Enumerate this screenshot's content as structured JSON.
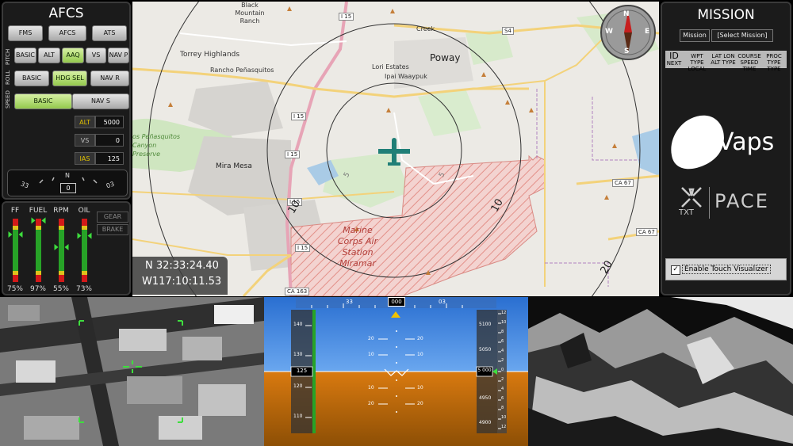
{
  "afcs": {
    "title": "AFCS",
    "top_buttons": [
      "FMS",
      "AFCS",
      "ATS"
    ],
    "pitch_label": "PITCH",
    "pitch_buttons": [
      "BASIC",
      "ALT",
      "AAQ",
      "VS",
      "NAV P"
    ],
    "roll_label": "ROLL",
    "roll_buttons": [
      "BASIC",
      "HDG SEL",
      "NAV R"
    ],
    "speed_label": "SPEED",
    "speed_buttons": [
      "BASIC",
      "NAV S"
    ],
    "readouts": [
      {
        "label": "ALT",
        "value": "5000",
        "alert": true
      },
      {
        "label": "VS",
        "value": "0",
        "alert": false
      },
      {
        "label": "IAS",
        "value": "125",
        "alert": true
      }
    ],
    "heading_tape": {
      "left": "33",
      "center": "N",
      "right": "03",
      "value": "0"
    }
  },
  "engine": {
    "gauges": [
      {
        "label": "FF",
        "value": "75%",
        "level": 0.75
      },
      {
        "label": "FUEL",
        "value": "97%",
        "level": 0.97
      },
      {
        "label": "RPM",
        "value": "55%",
        "level": 0.55
      },
      {
        "label": "OIL",
        "value": "73%",
        "level": 0.73
      }
    ],
    "gear_label": "GEAR",
    "brake_label": "BRAKE"
  },
  "map": {
    "place_labels": [
      {
        "text": "Black Mountain Ranch"
      },
      {
        "text": "Torrey Highlands"
      },
      {
        "text": "Rancho Peñasquitos"
      },
      {
        "text": "Lori Estates"
      },
      {
        "text": "Ipai Waaypuk"
      },
      {
        "text": "Poway"
      },
      {
        "text": "Creek"
      },
      {
        "text": "os Peñasquitos Canyon Preserve"
      },
      {
        "text": "Mira Mesa"
      },
      {
        "text": "Marine Corps Air Station Miramar"
      }
    ],
    "road_labels": [
      "I 15",
      "S4",
      "I 15",
      "I 15",
      "I 15",
      "I 15",
      "CA 67",
      "CA 67",
      "CA 163"
    ],
    "range_labels": [
      "10",
      "10",
      "20",
      "5",
      "5"
    ],
    "lat": "N 32:33:24.40",
    "lon": "W117:10:11.53",
    "compass": {
      "n": "N",
      "e": "E",
      "s": "S",
      "w": "W"
    }
  },
  "mission": {
    "title": "MISSION",
    "mission_button": "Mission",
    "select_button": "[Select Mission]",
    "table_headers": [
      {
        "top": "ID",
        "bottom": "NEXT"
      },
      {
        "top": "WPT TYPE",
        "bottom": "LOCAL"
      },
      {
        "top": "LAT LON",
        "bottom": "ALT TYPE"
      },
      {
        "top": "COURSE SPEED",
        "bottom": "TIME"
      },
      {
        "top": "PROC TYPE",
        "bottom": "TYPE"
      }
    ],
    "vaps_logo": "Vaps",
    "txt_logo": "TXT",
    "pace_logo": "PACE",
    "touch_checkbox_label": "Enable Touch Visualizer",
    "touch_checked": true
  },
  "pfd": {
    "heading_ticks": [
      "33",
      "000",
      "03"
    ],
    "speed_ticks": [
      "140",
      "130",
      "120",
      "110"
    ],
    "speed_value": "125",
    "alt_ticks": [
      "5100",
      "5050",
      "4950",
      "4900"
    ],
    "alt_value": "5 000",
    "pitch_ticks": [
      "20",
      "10",
      "10",
      "20"
    ],
    "vs_ticks": [
      "12",
      "10",
      "8",
      "6",
      "4",
      "2",
      "0",
      "2",
      "4",
      "6",
      "8",
      "10",
      "12"
    ]
  }
}
